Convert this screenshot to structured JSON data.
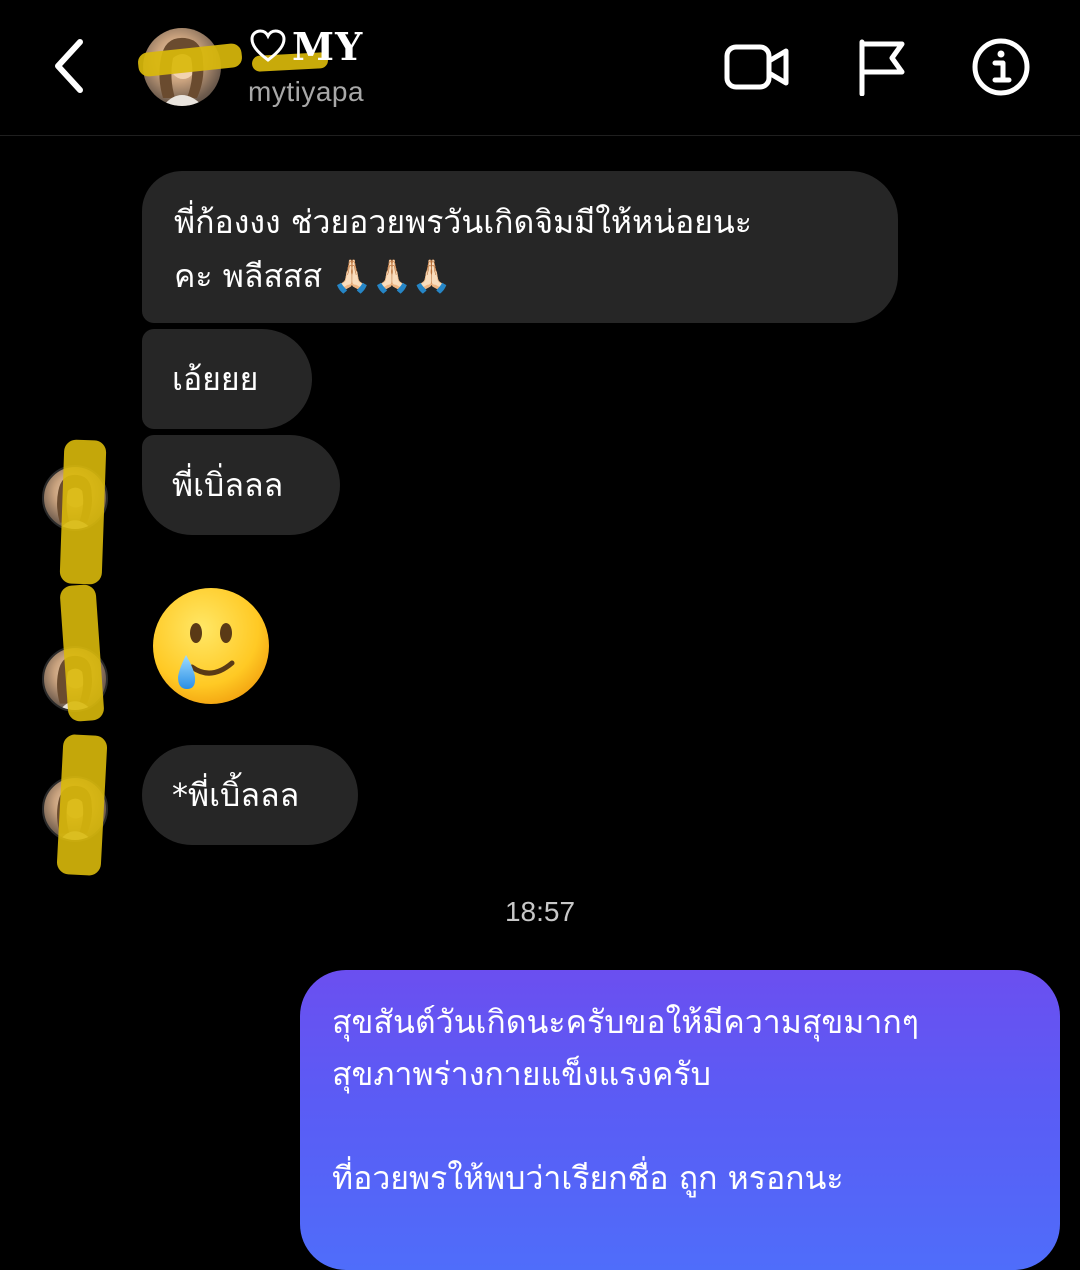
{
  "header": {
    "contact_name": "MY",
    "contact_handle": "mytiyapa",
    "icons": [
      "back-icon",
      "heart-outline-icon",
      "video-call-icon",
      "flag-icon",
      "info-icon"
    ]
  },
  "messages": {
    "incoming": [
      {
        "text": "พี่ก้องงง ช่วยอวยพรวันเกิดจิมมีให้หน่อยนะ\nคะ พลีสสส 🙏🏻🙏🏻🙏🏻"
      },
      {
        "text": "เอ้ยยย"
      },
      {
        "text": "พี่เบิ่ลลล"
      },
      {
        "text": "*พี่เบิ้ลลล"
      }
    ],
    "emoji_message": "smiling-face-with-tear-icon",
    "timestamp": "18:57",
    "outgoing": {
      "line1": "สุขสันต์วันเกิดนะครับขอให้มีความสุขมากๆ",
      "line2": "สุขภาพร่างกายแข็งแรงครับ",
      "line3": "ที่อวยพรให้พบว่าเรียกชื่อ ถูก หรอกนะ"
    }
  },
  "colors": {
    "background": "#000000",
    "incoming_bubble": "#262626",
    "outgoing_gradient_start": "#6b4ff0",
    "outgoing_gradient_end": "#4f6dfa",
    "scribble": "#d9b90b",
    "secondary_text": "#a8a8a8"
  }
}
